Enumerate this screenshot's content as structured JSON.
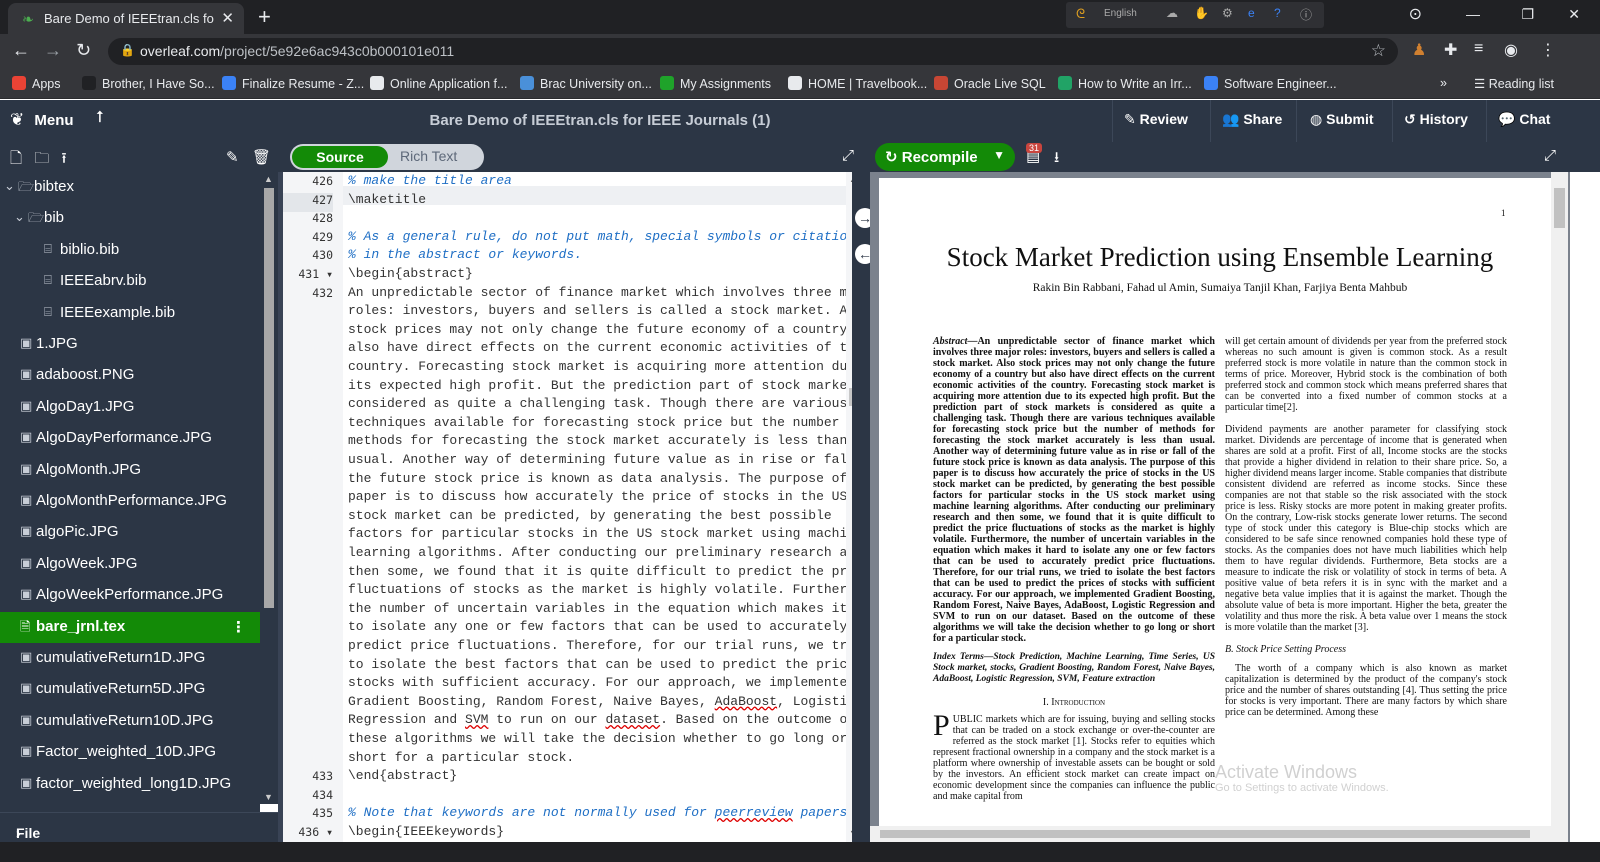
{
  "browser": {
    "tab_title": "Bare Demo of IEEEtran.cls for IEEE",
    "tab_close": "✕",
    "new_tab": "+",
    "url_host": "overleaf.com",
    "url_path": "/project/5e92e6ac943c0b000101e011",
    "ime_language": "English",
    "bookmarks": [
      {
        "label": "Apps",
        "color": "#ea4335"
      },
      {
        "label": "Brother, I Have So...",
        "color": "#202124"
      },
      {
        "label": "Finalize Resume - Z...",
        "color": "#3b82f6"
      },
      {
        "label": "Online Application f...",
        "color": "#e8eaed"
      },
      {
        "label": "Brac University on...",
        "color": "#4a90d9"
      },
      {
        "label": "My Assignments",
        "color": "#1fa32a"
      },
      {
        "label": "HOME | Travelbook...",
        "color": "#e8eaed"
      },
      {
        "label": "Oracle Live SQL",
        "color": "#c74634"
      },
      {
        "label": "How to Write an Irr...",
        "color": "#21a366"
      },
      {
        "label": "Software Engineer...",
        "color": "#3b82f6"
      }
    ],
    "more_bookmarks": "»",
    "reading_list": "Reading list"
  },
  "toolbar": {
    "menu_label": "Menu",
    "project_title": "Bare Demo of IEEEtran.cls for IEEE Journals (1)",
    "review": "Review",
    "share": "Share",
    "submit": "Submit",
    "history": "History",
    "chat": "Chat"
  },
  "editor_toggle": {
    "source": "Source",
    "rich_text": "Rich Text"
  },
  "pdf_toolbar": {
    "recompile": "Recompile",
    "log_badge": "31"
  },
  "file_tree": [
    {
      "label": "bibtex",
      "type": "folder",
      "indent": 0
    },
    {
      "label": "bib",
      "type": "folder",
      "indent": 1
    },
    {
      "label": "biblio.bib",
      "type": "file",
      "indent": 2
    },
    {
      "label": "IEEEabrv.bib",
      "type": "file",
      "indent": 2
    },
    {
      "label": "IEEEexample.bib",
      "type": "file",
      "indent": 2
    },
    {
      "label": "1.JPG",
      "type": "image",
      "indent": 0
    },
    {
      "label": "adaboost.PNG",
      "type": "image",
      "indent": 0
    },
    {
      "label": "AlgoDay1.JPG",
      "type": "image",
      "indent": 0
    },
    {
      "label": "AlgoDayPerformance.JPG",
      "type": "image",
      "indent": 0
    },
    {
      "label": "AlgoMonth.JPG",
      "type": "image",
      "indent": 0
    },
    {
      "label": "AlgoMonthPerformance.JPG",
      "type": "image",
      "indent": 0
    },
    {
      "label": "algoPic.JPG",
      "type": "image",
      "indent": 0
    },
    {
      "label": "AlgoWeek.JPG",
      "type": "image",
      "indent": 0
    },
    {
      "label": "AlgoWeekPerformance.JPG",
      "type": "image",
      "indent": 0
    },
    {
      "label": "bare_jrnl.tex",
      "type": "tex",
      "indent": 0,
      "selected": true
    },
    {
      "label": "cumulativeReturn1D.JPG",
      "type": "image",
      "indent": 0
    },
    {
      "label": "cumulativeReturn5D.JPG",
      "type": "image",
      "indent": 0
    },
    {
      "label": "cumulativeReturn10D.JPG",
      "type": "image",
      "indent": 0
    },
    {
      "label": "Factor_weighted_10D.JPG",
      "type": "image",
      "indent": 0
    },
    {
      "label": "factor_weighted_long1D.JPG",
      "type": "image",
      "indent": 0
    }
  ],
  "file_outline": "File outline",
  "code_lines": [
    {
      "n": "426",
      "text": "% make the title area",
      "style": "cm"
    },
    {
      "n": "427",
      "text": "\\maketitle",
      "style": "kw"
    },
    {
      "n": "428",
      "text": "",
      "style": "kw"
    },
    {
      "n": "429",
      "text": "% As a general rule, do not put math, special symbols or citations",
      "style": "cm"
    },
    {
      "n": "430",
      "text": "% in the abstract or keywords.",
      "style": "cm"
    },
    {
      "n": "431 ▾",
      "text": "\\begin{abstract}",
      "style": "kw"
    },
    {
      "n": "432",
      "text": "An unpredictable sector of finance market which involves three major",
      "style": "kw"
    },
    {
      "n": "",
      "text": "roles: investors, buyers and sellers is called a stock market. Also",
      "style": "kw"
    },
    {
      "n": "",
      "text": "stock prices may not only change the future economy of a country but",
      "style": "kw"
    },
    {
      "n": "",
      "text": "also have direct effects on the current economic activities of the",
      "style": "kw"
    },
    {
      "n": "",
      "text": "country. Forecasting stock market is acquiring more attention due to",
      "style": "kw"
    },
    {
      "n": "",
      "text": "its expected high profit. But the prediction part of stock markets is",
      "style": "kw"
    },
    {
      "n": "",
      "text": "considered as quite a challenging task. Though there are various",
      "style": "kw"
    },
    {
      "n": "",
      "text": "techniques available for forecasting stock price but the number of",
      "style": "kw"
    },
    {
      "n": "",
      "text": "methods for forecasting the stock market accurately is less than",
      "style": "kw"
    },
    {
      "n": "",
      "text": "usual. Another way of determining future value as in rise or fall of",
      "style": "kw"
    },
    {
      "n": "",
      "text": "the future stock price is known as data analysis. The purpose of this",
      "style": "kw"
    },
    {
      "n": "",
      "text": "paper is to discuss how accurately the price of stocks in the US",
      "style": "kw"
    },
    {
      "n": "",
      "text": "stock market can be predicted, by generating the best possible",
      "style": "kw"
    },
    {
      "n": "",
      "text": "factors for particular stocks in the US stock market using machine",
      "style": "kw"
    },
    {
      "n": "",
      "text": "learning algorithms. After conducting our preliminary research and",
      "style": "kw"
    },
    {
      "n": "",
      "text": "then some, we found that it is quite difficult to predict the price",
      "style": "kw"
    },
    {
      "n": "",
      "text": "fluctuations of stocks as the market is highly volatile. Furthermore,",
      "style": "kw"
    },
    {
      "n": "",
      "text": "the number of uncertain variables in the equation which makes it hard",
      "style": "kw"
    },
    {
      "n": "",
      "text": "to isolate any one or few factors that can be used to accurately",
      "style": "kw"
    },
    {
      "n": "",
      "text": "predict price fluctuations. Therefore, for our trial runs, we tried",
      "style": "kw"
    },
    {
      "n": "",
      "text": "to isolate the best factors that can be used to predict the prices of",
      "style": "kw"
    },
    {
      "n": "",
      "text": "stocks with sufficient accuracy. For our approach, we implemented",
      "style": "kw"
    },
    {
      "n": "",
      "text": "Gradient Boosting, Random Forest, Naive Bayes, AdaBoost, Logistic",
      "style": "kw"
    },
    {
      "n": "",
      "text": "Regression and SVM to run on our dataset. Based on the outcome of",
      "style": "kw"
    },
    {
      "n": "",
      "text": "these algorithms we will take the decision whether to go long or",
      "style": "kw"
    },
    {
      "n": "",
      "text": "short for a particular stock.",
      "style": "kw"
    },
    {
      "n": "433",
      "text": "\\end{abstract}",
      "style": "kw"
    },
    {
      "n": "434",
      "text": "",
      "style": "kw"
    },
    {
      "n": "435",
      "text": "% Note that keywords are not normally used for peerreview papers.",
      "style": "cm"
    },
    {
      "n": "436 ▾",
      "text": "\\begin{IEEEkeywords}",
      "style": "kw"
    }
  ],
  "pdf": {
    "page_number": "1",
    "title": "Stock Market Prediction using Ensemble Learning",
    "authors": "Rakin Bin Rabbani, Fahad ul Amin, Sumaiya Tanjil Khan, Farjiya Benta Mahbub",
    "abstract_label": "Abstract—",
    "abstract_text": "An unpredictable sector of finance market which involves three major roles: investors, buyers and sellers is called a stock market. Also stock prices may not only change the future economy of a country but also have direct effects on the current economic activities of the country. Forecasting stock market is acquiring more attention due to its expected high profit. But the prediction part of stock markets is considered as quite a challenging task. Though there are various techniques available for forecasting stock price but the number of methods for forecasting the stock market accurately is less than usual. Another way of determining future value as in rise or fall of the future stock price is known as data analysis. The purpose of this paper is to discuss how accurately the price of stocks in the US stock market can be predicted, by generating the best possible factors for particular stocks in the US stock market using machine learning algorithms. After conducting our preliminary research and then some, we found that it is quite difficult to predict the price fluctuations of stocks as the market is highly volatile. Furthermore, the number of uncertain variables in the equation which makes it hard to isolate any one or few factors that can be used to accurately predict price fluctuations. Therefore, for our trial runs, we tried to isolate the best factors that can be used to predict the prices of stocks with sufficient accuracy. For our approach, we implemented Gradient Boosting, Random Forest, Naive Bayes, AdaBoost, Logistic Regression and SVM to run on our dataset. Based on the outcome of these algorithms we will take the decision whether to go long or short for a particular stock.",
    "index_terms": "Index Terms—Stock Prediction, Machine Learning, Time Series, US Stock market, stocks, Gradient Boosting, Random Forest, Naive Bayes, AdaBoost, Logistic Regression, SVM, Feature extraction",
    "section_intro": "I. Introduction",
    "intro_dropcap": "P",
    "intro_text": "UBLIC markets which are for issuing, buying and selling stocks that can be traded on a stock exchange or over-the-counter are referred as the stock market [1]. Stocks refer to equities which represent fractional ownership in a company and the stock market is a platform where ownership of investable assets can be bought or sold by the investors. An efficient stock market can create impact on economic development since the companies can influence the public and make capital from",
    "right_p1": "will get certain amount of dividends per year from the preferred stock whereas no such amount is given is common stock. As a result preferred stock is more volatile in nature than the common stock in terms of price. Moreover, Hybrid stock is the combination of both preferred stock and common stock which means preferred shares that can be converted into a fixed number of common stocks at a particular time[2].",
    "right_p2": "Dividend payments are another parameter for classifying stock market. Dividends are percentage of income that is generated when shares are sold at a profit. First of all, Income stocks are the stocks that provide a higher dividend in relation to their share price. So, a higher dividend means larger income. Stable companies that distribute consistent dividend are referred as income stocks. Since these companies are not that stable so the risk associated with the stock price is less. Risky stocks are more potent in making greater profits. On the contrary, Low-risk stocks generate lower returns. The second type of stock under this category is Blue-chip stocks which are considered to be safe since renowned companies hold these type of stocks. As the companies does not have much liabilities which help them to have regular dividends. Furthermore, Beta stocks are a measure to indicate the risk or volatility of stock in terms of beta. A positive value of beta refers it is in sync with the market and a negative beta value implies that it is against the market. Though the absolute value of beta is more important. Higher the beta, greater the volatility and thus more the risk. A beta value over 1 means the stock is more volatile than the market [3].",
    "right_sub": "B. Stock Price Setting Process",
    "right_p3": "The worth of a company which is also known as market capitalization is determined by the product of the company's stock price and the number of shares outstanding [4]. Thus setting the price for stocks is very important. There are many factors by which share price can be determined. Among these",
    "watermark": "Activate Windows",
    "watermark_sub": "Go to Settings to activate Windows."
  }
}
